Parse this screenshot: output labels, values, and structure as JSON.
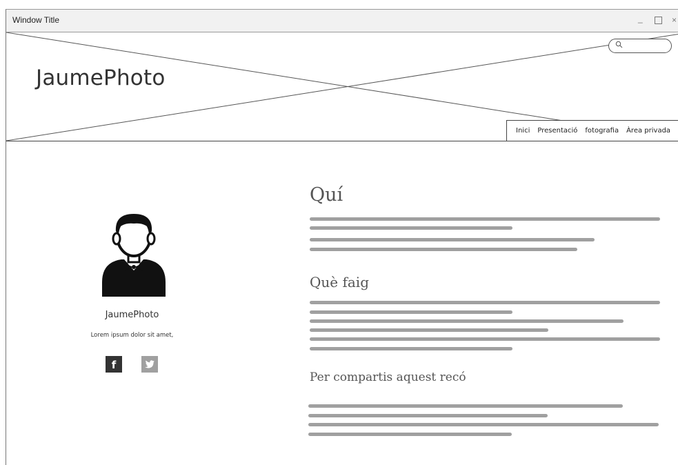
{
  "window": {
    "title": "Window Title",
    "controls": [
      "minimize",
      "maximize",
      "close"
    ]
  },
  "header": {
    "brand": "JaumePhoto",
    "search": {
      "placeholder": "",
      "value": ""
    },
    "nav": [
      "Inici",
      "Presentació",
      "fotografia",
      "Àrea privada"
    ]
  },
  "profile": {
    "name": "JaumePhoto",
    "bio": "Lorem ipsum dolor sit amet,",
    "social": [
      {
        "label": "f",
        "icon": "facebook-icon"
      },
      {
        "label": "",
        "icon": "twitter-icon"
      }
    ]
  },
  "content": {
    "sections": [
      {
        "heading": "Quí"
      },
      {
        "heading": "Què faig"
      },
      {
        "heading": "Per compartis aquest recó"
      }
    ]
  },
  "colors": {
    "placeholder_line": "#a0a0a0",
    "border": "#444444",
    "titlebar": "#f1f1f1"
  }
}
